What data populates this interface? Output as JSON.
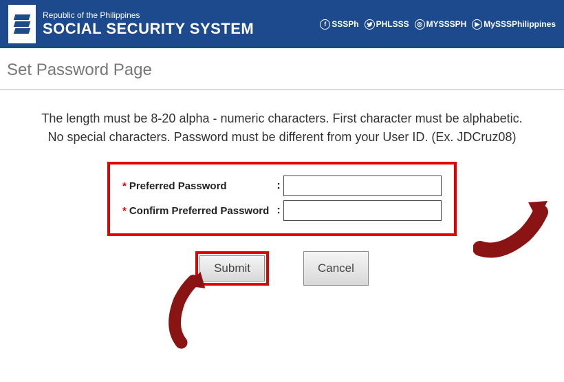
{
  "header": {
    "subtitle": "Republic of the Philippines",
    "title": "SOCIAL SECURITY SYSTEM",
    "social": [
      {
        "icon": "f",
        "label": "SSSPh"
      },
      {
        "icon": "t",
        "label": "PHLSSS"
      },
      {
        "icon": "ig",
        "label": "MYSSSPH"
      },
      {
        "icon": "yt",
        "label": "MySSSPhilippines"
      }
    ]
  },
  "page_title": "Set Password Page",
  "instruction_line1": "The length must be 8-20 alpha - numeric characters. First character must be alphabetic.",
  "instruction_line2": "No special characters. Password must be different from your User ID. (Ex. JDCruz08)",
  "form": {
    "asterisk": "*",
    "preferred_label": "Preferred Password",
    "confirm_label": "Confirm Preferred Password",
    "colon": ":"
  },
  "buttons": {
    "submit": "Submit",
    "cancel": "Cancel"
  }
}
